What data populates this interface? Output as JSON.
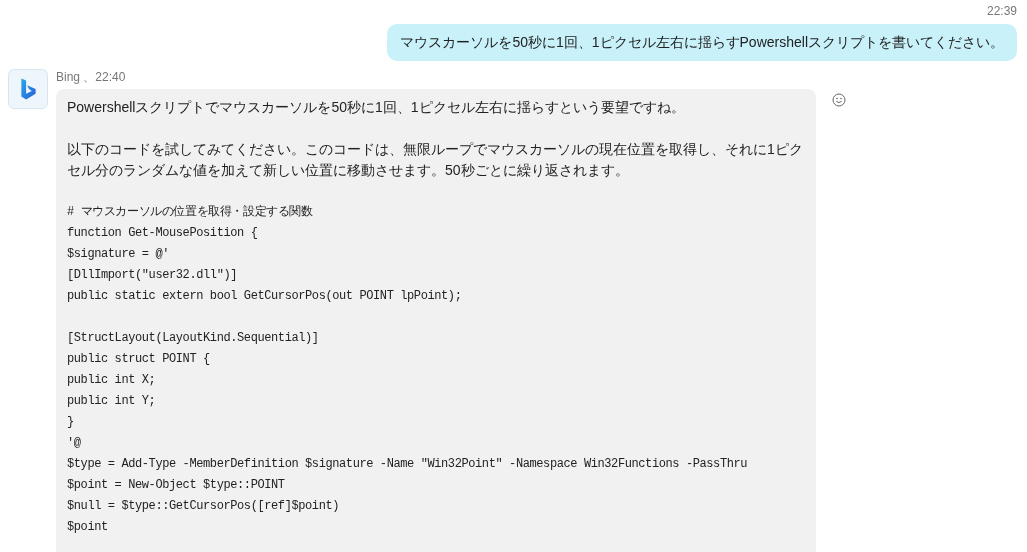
{
  "user_message": {
    "time": "22:39",
    "text": "マウスカーソルを50秒に1回、1ピクセル左右に揺らすPowershellスクリプトを書いてください。"
  },
  "bot_message": {
    "sender": "Bing 、22:40",
    "blocks": [
      {
        "kind": "text",
        "text": "Powershellスクリプトでマウスカーソルを50秒に1回、1ピクセル左右に揺らすという要望ですね。"
      },
      {
        "kind": "text",
        "text": "以下のコードを試してみてください。このコードは、無限ループでマウスカーソルの現在位置を取得し、それに1ピクセル分のランダムな値を加えて新しい位置に移動させます。50秒ごとに繰り返されます。"
      },
      {
        "kind": "code",
        "lines": [
          "# マウスカーソルの位置を取得・設定する関数",
          "function Get-MousePosition {",
          "$signature = @'",
          "[DllImport(\"user32.dll\")]",
          "public static extern bool GetCursorPos(out POINT lpPoint);"
        ]
      },
      {
        "kind": "code",
        "lines": [
          "[StructLayout(LayoutKind.Sequential)]",
          "public struct POINT {",
          "public int X;",
          "public int Y;",
          "}",
          "'@",
          "$type = Add-Type -MemberDefinition $signature -Name \"Win32Point\" -Namespace Win32Functions -PassThru",
          "$point = New-Object $type::POINT",
          "$null = $type::GetCursorPos([ref]$point)",
          "$point"
        ]
      }
    ]
  }
}
